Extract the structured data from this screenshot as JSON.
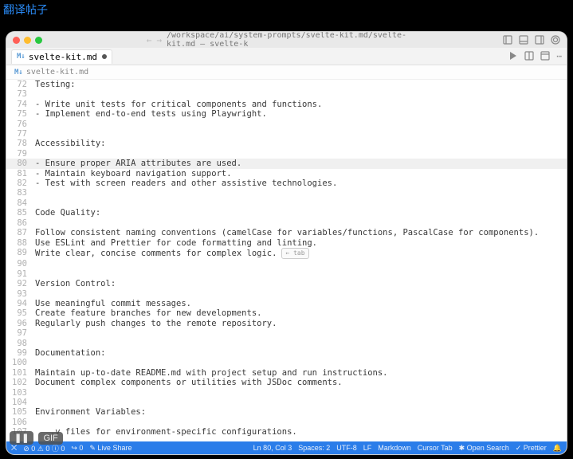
{
  "caption": "翻译帖子",
  "titlebar": {
    "path": "/workspace/ai/system-prompts/svelte-kit.md/svelte-kit.md — svelte-k"
  },
  "tab": {
    "label": "svelte-kit.md"
  },
  "breadcrumb": {
    "label": "svelte-kit.md"
  },
  "editor": {
    "start": 72,
    "highlight": 80,
    "hintLine": 89,
    "hintLabel": "← tab",
    "lines": [
      "Testing:",
      "",
      "- Write unit tests for critical components and functions.",
      "- Implement end-to-end tests using Playwright.",
      "",
      "",
      "Accessibility:",
      "",
      "- Ensure proper ARIA attributes are used.",
      "- Maintain keyboard navigation support.",
      "- Test with screen readers and other assistive technologies.",
      "",
      "",
      "Code Quality:",
      "",
      "Follow consistent naming conventions (camelCase for variables/functions, PascalCase for components).",
      "Use ESLint and Prettier for code formatting and linting.",
      "Write clear, concise comments for complex logic.",
      "",
      "",
      "Version Control:",
      "",
      "Use meaningful commit messages.",
      "Create feature branches for new developments.",
      "Regularly push changes to the remote repository.",
      "",
      "",
      "Documentation:",
      "",
      "Maintain up-to-date README.md with project setup and run instructions.",
      "Document complex components or utilities with JSDoc comments.",
      "",
      "",
      "Environment Variables:",
      "",
      "   .v files for environment-specific configurations."
    ]
  },
  "status": {
    "remote": "⨉",
    "errors": "⊘ 0 ⚠ 0 ⓘ 0",
    "ports": "↪ 0",
    "liveshare": "✎ Live Share",
    "cursor": "Ln 80, Col 3",
    "spaces": "Spaces: 2",
    "encoding": "UTF-8",
    "eol": "LF",
    "language": "Markdown",
    "cursortab": "Cursor Tab",
    "opensearch": "✱ Open Search",
    "prettier": "✓ Prettier"
  },
  "overlay": {
    "pause": "❚❚",
    "gif": "GIF"
  }
}
